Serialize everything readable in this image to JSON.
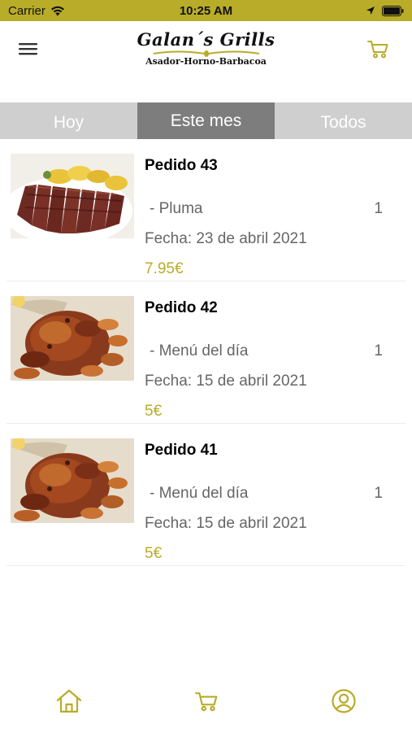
{
  "status_bar": {
    "carrier": "Carrier",
    "time": "10:25 AM"
  },
  "header": {
    "logo_title": "Galan´s Grills",
    "logo_subtitle": "Asador-Horno-Barbacoa",
    "menu_icon": "hamburger-menu-icon",
    "cart_icon": "cart-icon"
  },
  "tabs": [
    {
      "label": "Hoy",
      "active": false
    },
    {
      "label": "Este mes",
      "active": true
    },
    {
      "label": "Todos",
      "active": false
    }
  ],
  "orders": [
    {
      "title": "Pedido 43",
      "item": "- Pluma",
      "quantity": "1",
      "date": "Fecha: 23 de abril 2021",
      "price": "7.95€",
      "image": "steak-plate"
    },
    {
      "title": "Pedido 42",
      "item": "- Menú del día",
      "quantity": "1",
      "date": "Fecha: 15 de abril 2021",
      "price": "5€",
      "image": "roast-chicken"
    },
    {
      "title": "Pedido 41",
      "item": "- Menú del día",
      "quantity": "1",
      "date": "Fecha: 15 de abril 2021",
      "price": "5€",
      "image": "roast-chicken"
    }
  ],
  "bottom_nav": [
    {
      "icon": "home-icon"
    },
    {
      "icon": "cart-icon"
    },
    {
      "icon": "profile-icon"
    }
  ],
  "colors": {
    "accent": "#b9ac29",
    "tab_active": "#7d7d7d",
    "tab_inactive": "#cfcfcf"
  }
}
